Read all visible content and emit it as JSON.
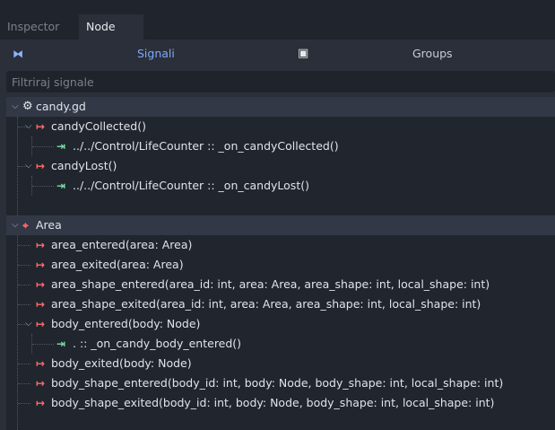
{
  "tabs": {
    "inspector": "Inspector",
    "node": "Node"
  },
  "toolbar": {
    "signals": "Signali",
    "groups": "Groups"
  },
  "filter": {
    "placeholder": "Filtriraj signale"
  },
  "tree": {
    "script": "candy.gd",
    "candyCollected": "candyCollected()",
    "candyCollected_conn": "../../Control/LifeCounter :: _on_candyCollected()",
    "candyLost": "candyLost()",
    "candyLost_conn": "../../Control/LifeCounter :: _on_candyLost()",
    "area": "Area",
    "area_entered": "area_entered(area: Area)",
    "area_exited": "area_exited(area: Area)",
    "area_shape_entered": "area_shape_entered(area_id: int, area: Area, area_shape: int, local_shape: int)",
    "area_shape_exited": "area_shape_exited(area_id: int, area: Area, area_shape: int, local_shape: int)",
    "body_entered": "body_entered(body: Node)",
    "body_entered_conn": ". :: _on_candy_body_entered()",
    "body_exited": "body_exited(body: Node)",
    "body_shape_entered": "body_shape_entered(body_id: int, body: Node, body_shape: int, local_shape: int)",
    "body_shape_exited": "body_shape_exited(body_id: int, body: Node, body_shape: int, local_shape: int)"
  },
  "icons": {
    "signal": "signal-icon",
    "connection": "connection-icon",
    "script": "gear-icon",
    "area": "area-icon"
  },
  "colors": {
    "signal": "#ff6b6b",
    "connection": "#7ee0a8",
    "accent": "#7fa8ff"
  }
}
